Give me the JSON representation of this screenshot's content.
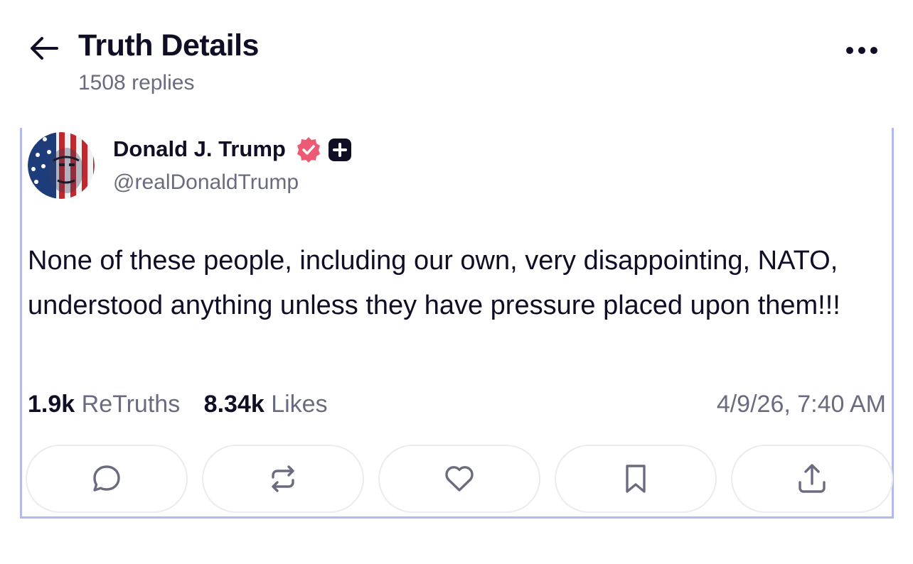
{
  "header": {
    "title": "Truth Details",
    "reply_count": "1508 replies",
    "back_icon": "arrow-left-icon",
    "more_icon": "more-horizontal-icon"
  },
  "post": {
    "author_name": "Donald J. Trump",
    "handle": "@realDonaldTrump",
    "verified_icon": "verified-badge-icon",
    "verified_color": "#ec5a74",
    "body": "None of these people, including our own, very disappointing, NATO, understood anything unless they have pressure placed upon them!!!",
    "stats": {
      "retruths_count": "1.9k",
      "retruths_label": "ReTruths",
      "likes_count": "8.34k",
      "likes_label": "Likes"
    },
    "timestamp": "4/9/26, 7:40 AM"
  },
  "actions": [
    {
      "name": "reply",
      "icon": "reply-bubble-icon"
    },
    {
      "name": "retruth",
      "icon": "retruth-icon"
    },
    {
      "name": "like",
      "icon": "heart-icon"
    },
    {
      "name": "bookmark",
      "icon": "bookmark-icon"
    },
    {
      "name": "share",
      "icon": "share-icon"
    }
  ],
  "colors": {
    "text": "#0f0e25",
    "muted": "#6b6b80",
    "card_border": "#b3b8ee",
    "action_border": "#ebebf0"
  }
}
